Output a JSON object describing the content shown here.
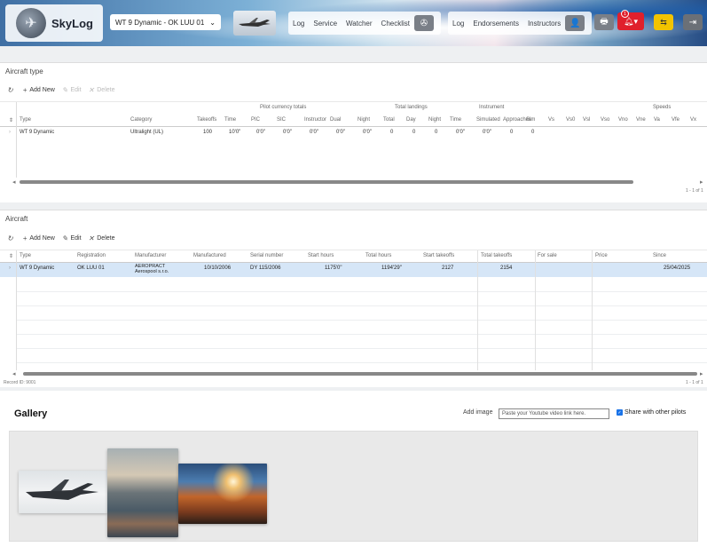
{
  "header": {
    "brand": "SkyLog",
    "aircraft_select": "WT 9 Dynamic - OK LUU 01",
    "nav": [
      "Log",
      "Service",
      "Watcher",
      "Checklist",
      "Log",
      "Endorsements",
      "Instructors"
    ],
    "notification_count": "1"
  },
  "aircraft_type": {
    "title": "Aircraft type",
    "toolbar": {
      "refresh": "",
      "add": "Add New",
      "edit": "Edit",
      "delete": "Delete"
    },
    "group_headers": [
      "Pilot currency totals",
      "Total landings",
      "Instrument",
      "Speeds"
    ],
    "columns": [
      "Type",
      "Category",
      "Takeoffs",
      "Time",
      "PIC",
      "SIC",
      "Instructor",
      "Dual",
      "Night",
      "Total",
      "Day",
      "Night",
      "Time",
      "Simulated",
      "Approaches",
      "Sim",
      "Vs",
      "Vs0",
      "Vsl",
      "Vso",
      "Vno",
      "Vne",
      "Va",
      "Vfe",
      "Vx"
    ],
    "rows": [
      [
        "WT 9 Dynamic",
        "Ultralight (UL)",
        "100",
        "10'0\"",
        "0'0\"",
        "0'0\"",
        "0'0\"",
        "0'0\"",
        "0'0\"",
        "0",
        "0",
        "0",
        "0'0\"",
        "0'0\"",
        "0",
        "0"
      ]
    ],
    "pager": "1 - 1 of 1"
  },
  "aircraft": {
    "title": "Aircraft",
    "toolbar": {
      "refresh": "",
      "add": "Add New",
      "edit": "Edit",
      "delete": "Delete"
    },
    "columns": [
      "Type",
      "Registration",
      "Manufacturer",
      "Manufactured",
      "Serial number",
      "Start hours",
      "Total hours",
      "Start takeoffs",
      "Total takeoffs",
      "For sale",
      "Price",
      "Since"
    ],
    "rows": [
      [
        "WT 9 Dynamic",
        "OK LUU 01",
        "AEROPRACT Aerospool s.r.o.",
        "10/10/2006",
        "DY 115/2006",
        "1175'0\"",
        "1194'29\"",
        "2127",
        "2154",
        "",
        "",
        "25/04/2025"
      ]
    ],
    "record_id": "Record ID: 9001",
    "pager": "1 - 1 of 1"
  },
  "gallery": {
    "title": "Gallery",
    "add_label": "Add image",
    "input_placeholder": "Paste your Youtube video link here.",
    "share_label": "Share with other pilots",
    "share_checked": true
  }
}
